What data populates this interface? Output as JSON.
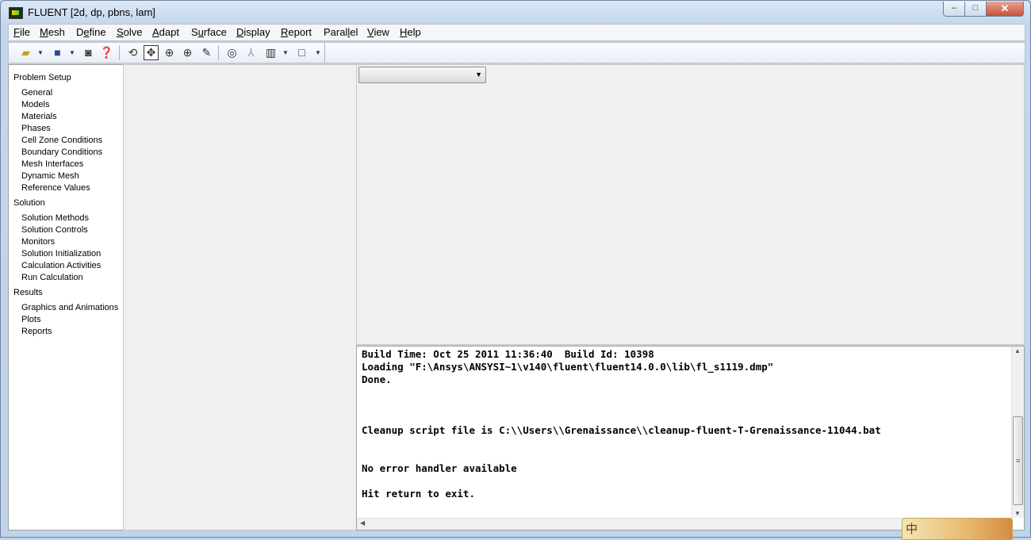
{
  "window": {
    "title": "FLUENT  [2d, dp, pbns, lam]",
    "controls": {
      "minimize": "–",
      "maximize": "□",
      "close": "✕"
    }
  },
  "menu": [
    {
      "pre": "",
      "mn": "F",
      "post": "ile"
    },
    {
      "pre": "",
      "mn": "M",
      "post": "esh"
    },
    {
      "pre": "D",
      "mn": "e",
      "post": "fine"
    },
    {
      "pre": "",
      "mn": "S",
      "post": "olve"
    },
    {
      "pre": "",
      "mn": "A",
      "post": "dapt"
    },
    {
      "pre": "S",
      "mn": "u",
      "post": "rface"
    },
    {
      "pre": "",
      "mn": "D",
      "post": "isplay"
    },
    {
      "pre": "",
      "mn": "R",
      "post": "eport"
    },
    {
      "pre": "Paral",
      "mn": "l",
      "post": "el"
    },
    {
      "pre": "",
      "mn": "V",
      "post": "iew"
    },
    {
      "pre": "",
      "mn": "H",
      "post": "elp"
    }
  ],
  "toolbar": {
    "icons": [
      "open-folder-icon",
      "save-icon",
      "camera-icon",
      "help-icon",
      "rotate-icon",
      "translate-icon",
      "zoom-in-icon",
      "zoom-to-fit-icon",
      "probe-icon",
      "zoom-out-icon",
      "axes-icon",
      "layout-icon",
      "rectangle-icon"
    ]
  },
  "tree": {
    "problem_setup": {
      "label": "Problem Setup",
      "items": [
        "General",
        "Models",
        "Materials",
        "Phases",
        "Cell Zone Conditions",
        "Boundary Conditions",
        "Mesh Interfaces",
        "Dynamic Mesh",
        "Reference Values"
      ]
    },
    "solution": {
      "label": "Solution",
      "items": [
        "Solution Methods",
        "Solution Controls",
        "Monitors",
        "Solution Initialization",
        "Calculation Activities",
        "Run Calculation"
      ]
    },
    "results": {
      "label": "Results",
      "items": [
        "Graphics and Animations",
        "Plots",
        "Reports"
      ]
    }
  },
  "graphics": {
    "window_select_value": ""
  },
  "console": {
    "lines": [
      "Build Time: Oct 25 2011 11:36:40  Build Id: 10398",
      "Loading \"F:\\Ansys\\ANSYSI~1\\v140\\fluent\\fluent14.0.0\\lib\\fl_s1119.dmp\"",
      "Done.",
      "",
      "",
      "Cleanup script file is C:\\\\Users\\\\Grenaissance\\\\cleanup-fluent-T-Grenaissance-11044.bat",
      "",
      "",
      "No error handler available",
      "",
      "Hit return to exit."
    ]
  },
  "ime": {
    "char": "中"
  }
}
